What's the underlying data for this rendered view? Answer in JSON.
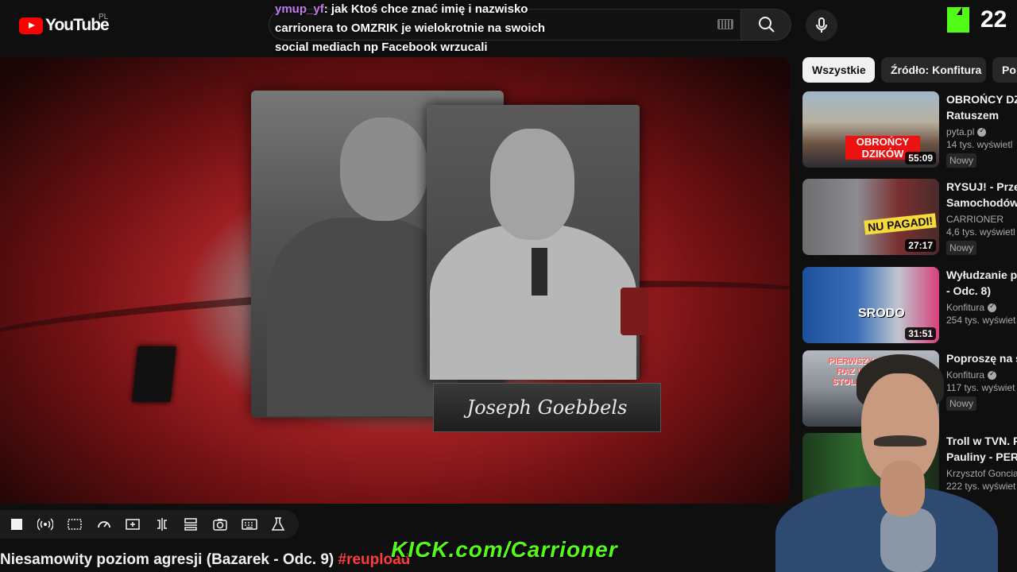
{
  "header": {
    "logo_text": "YouTube",
    "region": "PL",
    "search": {
      "placeholder": ""
    },
    "icons": [
      "keyboard-icon",
      "search-icon",
      "microphone-icon"
    ]
  },
  "chat": {
    "user": "ymup_yf",
    "message_line1": ": jak Ktoś chce znać imię i nazwisko",
    "message_line2": "carrionera to OMZRIK je wielokrotnie na swoich",
    "message_line3": "social mediach np Facebook wrzucali"
  },
  "kick": {
    "viewer_count": "22",
    "banner": "KICK.com/Carrioner",
    "brand_color": "#53fc18"
  },
  "video": {
    "nameplate": "Joseph Goebbels",
    "title": "Niesamowity poziom agresji (Bazarek - Odc. 9)",
    "hashtag": "#reupload"
  },
  "toolbar_icons": [
    "stop-icon",
    "broadcast-icon",
    "theater-icon",
    "speed-icon",
    "add-box-icon",
    "split-icon",
    "layout-icon",
    "camera-icon",
    "keyboard-icon",
    "lab-icon"
  ],
  "chips": [
    {
      "label": "Wszystkie",
      "active": true
    },
    {
      "label": "Źródło: Konfitura",
      "active": false
    },
    {
      "label": "Po",
      "active": false
    }
  ],
  "recommended": [
    {
      "title_line1": "OBROŃCY DZ",
      "title_line2": "Ratuszem",
      "channel": "pyta.pl",
      "verified": true,
      "views": "14 tys. wyświetl",
      "badge": "Nowy",
      "duration": "55:09",
      "thumb_text": "OBROŃCY DZIKÓW"
    },
    {
      "title_line1": "RYSUJ! - Prze",
      "title_line2": "Samochodów",
      "channel": "CARRIONER",
      "verified": false,
      "views": "4,6 tys. wyświetl",
      "badge": "Nowy",
      "duration": "27:17",
      "thumb_text": "NU PAGADI!"
    },
    {
      "title_line1": "Wyłudzanie pi",
      "title_line2": "- Odc. 8)",
      "channel": "Konfitura",
      "verified": true,
      "views": "254 tys. wyświet",
      "badge": "",
      "duration": "31:51",
      "thumb_text": "SRODO"
    },
    {
      "title_line1": "Poproszę na s",
      "title_line2": "",
      "channel": "Konfitura",
      "verified": true,
      "views": "117 tys. wyświet",
      "badge": "Nowy",
      "duration": "",
      "thumb_text": "PIERWSZY RAZ W STOLICY"
    },
    {
      "title_line1": "Troll w TVN. F",
      "title_line2": "Pauliny - PERS",
      "channel": "Krzysztof Goncia",
      "verified": false,
      "views": "222 tys. wyświet",
      "badge": "",
      "duration": "",
      "thumb_text": ""
    }
  ],
  "colors": {
    "background": "#0f0f0f",
    "accent": "#ff0000",
    "chip_active": "#f1f1f1",
    "chat_user": "#c37cf0"
  }
}
